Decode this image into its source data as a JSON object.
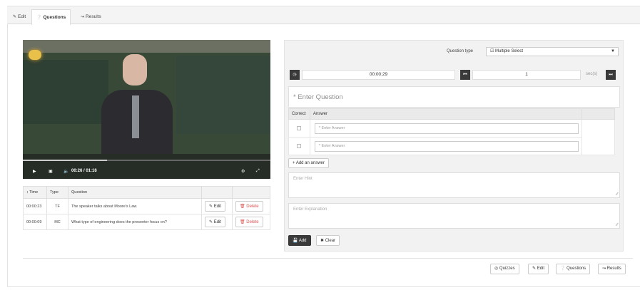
{
  "tabs": [
    {
      "label": "Edit",
      "icon": "pencil-icon"
    },
    {
      "label": "Questions",
      "icon": "question-circle-icon"
    },
    {
      "label": "Results",
      "icon": "chart-icon"
    }
  ],
  "video": {
    "time_display": "00:26 / 01:16",
    "progress": 0.34
  },
  "questions_table": {
    "headers": [
      "↕ Time",
      "Type",
      "Question",
      "",
      ""
    ],
    "rows": [
      {
        "time": "00:00:23",
        "type": "TF",
        "question": "The speaker talks about Moore's Law.",
        "edit": "Edit",
        "delete": "Delete"
      },
      {
        "time": "00:00:09",
        "type": "MC",
        "question": "What type of engineering does the presenter focus on?",
        "edit": "Edit",
        "delete": "Delete"
      }
    ]
  },
  "editor": {
    "question_type_label": "Question type",
    "question_type_value": "☑ Multiple Select",
    "time_value": "00:00:29",
    "secs_value": "1",
    "secs_label": "sec(s)",
    "question_placeholder": "* Enter Question",
    "answer_headers": [
      "Correct",
      "Answer"
    ],
    "answer_placeholders": [
      "* Enter Answer",
      "* Enter Answer"
    ],
    "add_answer": "Add an answer",
    "hint_placeholder": "Enter Hint",
    "explanation_placeholder": "Enter Explanation",
    "add_button": "Add",
    "clear_button": "Clear"
  },
  "footer": {
    "quizzes": "Quizzes",
    "edit": "Edit",
    "questions": "Questions",
    "results": "Results"
  }
}
